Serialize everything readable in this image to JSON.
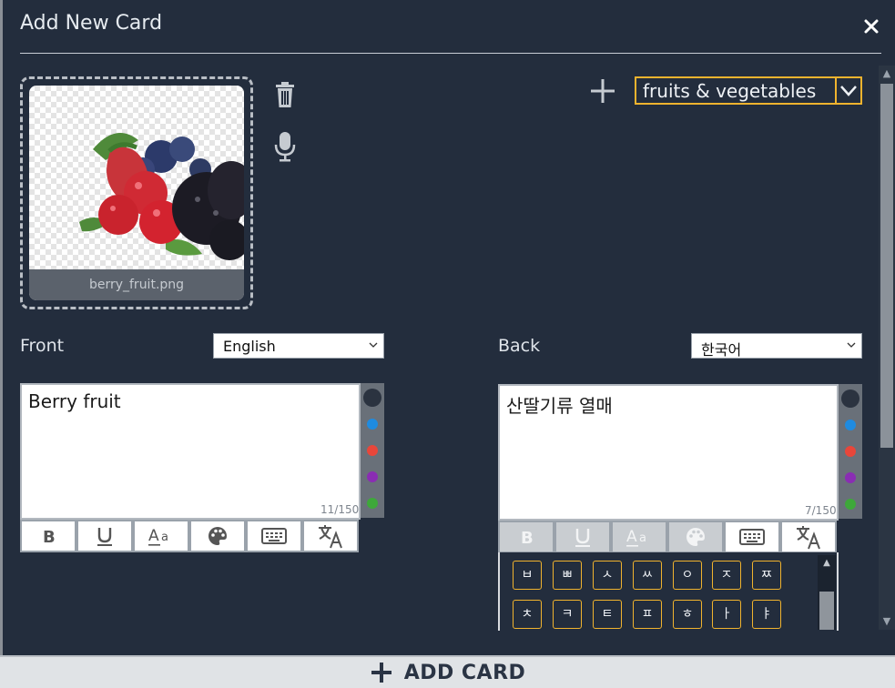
{
  "window": {
    "title": "Add New Card"
  },
  "image": {
    "filename": "berry_fruit.png"
  },
  "deck": {
    "selected": "fruits & vegetables"
  },
  "front": {
    "label": "Front",
    "language": "English",
    "text": "Berry fruit",
    "counter": "11/150"
  },
  "back": {
    "label": "Back",
    "language": "한국어",
    "text": "산딸기류 열매",
    "counter": "7/150"
  },
  "colors": [
    "#2b3340",
    "#1f8be0",
    "#e8463a",
    "#8a2db3",
    "#3ea83a"
  ],
  "toolbar_icons": [
    "bold-icon",
    "underline-icon",
    "font-size-icon",
    "palette-icon",
    "keyboard-icon",
    "translate-icon"
  ],
  "korean_keys": {
    "row1": [
      "ㅂ",
      "ㅃ",
      "ㅅ",
      "ㅆ",
      "ㅇ",
      "ㅈ",
      "ㅉ"
    ],
    "row2": [
      "ㅊ",
      "ㅋ",
      "ㅌ",
      "ㅍ",
      "ㅎ",
      "ㅏ",
      "ㅑ"
    ]
  },
  "footer": {
    "add_label": "ADD CARD"
  }
}
